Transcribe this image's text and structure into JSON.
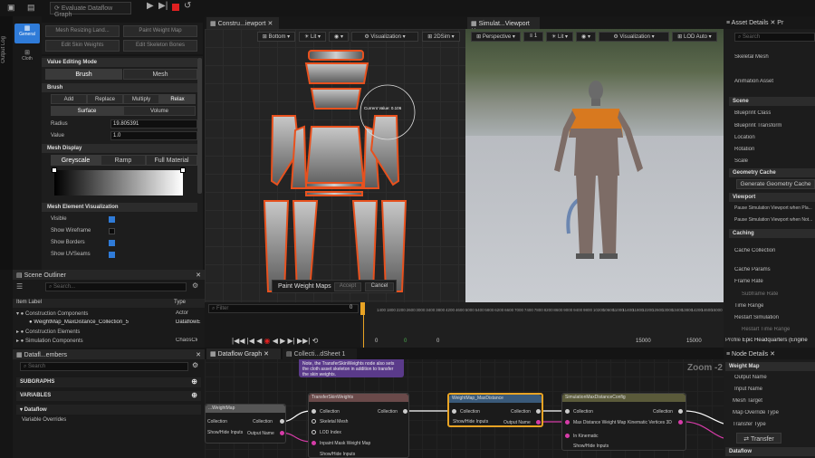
{
  "toolbar": {
    "title": "Evaluate Dataflow Graph"
  },
  "leftstrip": {
    "outputlog": "Output Log",
    "general": "General",
    "cloth": "Cloth"
  },
  "tools": {
    "mesh_resizing": "Mesh Resizing Land...",
    "paint_weight_map": "Paint Weight Map",
    "edit_skin_weights": "Edit Skin Weights",
    "edit_skeleton_bones": "Edit Skeleton Bones"
  },
  "props": {
    "value_editing_mode": "Value Editing Mode",
    "brush_tab": "Brush",
    "mesh_tab": "Mesh",
    "brush_section": "Brush",
    "add": "Add",
    "replace": "Replace",
    "multiply": "Multiply",
    "relax": "Relax",
    "surface": "Surface",
    "volume": "Volume",
    "radius_label": "Radius",
    "radius_value": "19.805391",
    "value_label": "Value",
    "value_value": "1.0",
    "mesh_display": "Mesh Display",
    "greyscale": "Greyscale",
    "ramp": "Ramp",
    "full_material": "Full Material",
    "mesh_element_vis": "Mesh Element Visualization",
    "visible": "Visible",
    "show_wireframe": "Show Wireframe",
    "show_borders": "Show Borders",
    "show_uvseams": "Show UVSeams"
  },
  "outliner": {
    "title": "Scene Outliner",
    "search_placeholder": "Search...",
    "col_label": "Item Label",
    "col_type": "Type",
    "rows": [
      {
        "label": "Construction Components",
        "type": "Actor"
      },
      {
        "label": "WeightMap_MaxDistance_Collection_5",
        "type": "DataflowE"
      },
      {
        "label": "Construction Elements",
        "type": ""
      },
      {
        "label": "Simulation Components",
        "type": "ChaosClo"
      }
    ]
  },
  "dataflow_members": {
    "title": "Datafl...embers",
    "search_placeholder": "Search",
    "subgraphs": "SUBGRAPHS",
    "variables": "VARIABLES",
    "dataflow": "Dataflow",
    "variable_overrides": "Variable Overrides"
  },
  "vp1": {
    "tab": "Constru...iewport",
    "bottom": "Bottom",
    "lit": "Lit",
    "visualization": "Visualization",
    "twodsim": "2DSim",
    "current_value": "Current Value: 0.106",
    "paint_label": "Paint Weight Maps",
    "accept": "Accept",
    "cancel": "Cancel"
  },
  "vp2": {
    "tab": "Simulat...Viewport",
    "perspective": "Perspective",
    "one": "1",
    "lit": "Lit",
    "visualization": "Visualization",
    "lod": "LOD Auto"
  },
  "timeline": {
    "filter_placeholder": "Filter",
    "frame": "0",
    "ticks": [
      "1400",
      "1800",
      "2200",
      "2600",
      "3000",
      "3400",
      "3800",
      "4200",
      "4600",
      "5000",
      "5400",
      "5800",
      "6200",
      "6600",
      "7000",
      "7400",
      "7800",
      "8200",
      "8600",
      "9000",
      "9400",
      "9800",
      "10200",
      "10600",
      "11000",
      "11400",
      "11800",
      "12200",
      "12600",
      "13000",
      "13400",
      "13800",
      "14200",
      "14600",
      "15000"
    ],
    "start": "0",
    "cur": "0",
    "end1": "15000",
    "end2": "15000"
  },
  "graph": {
    "tab1": "Dataflow Graph",
    "tab2": "Collecti...dSheet 1",
    "zoom": "Zoom -2",
    "comment": "Note, the TransferSkinWeights node also sets the cloth asset skeleton in addition to transfer the skin weights.",
    "nodes": {
      "wm": {
        "title": "...WeightMap",
        "collection": "Collection",
        "show_hide": "Show/Hide Inputs"
      },
      "tsw": {
        "title": "TransferSkinWeights",
        "collection": "Collection",
        "skeletal_mesh": "Skeletal Mesh",
        "lod_index": "LOD Index",
        "inpaint": "Inpaint Mask Weight Map",
        "show_hide": "Show/Hide Inputs"
      },
      "wmd": {
        "title": "WeightMap_MaxDistance",
        "collection": "Collection",
        "show_hide": "Show/Hide Inputs",
        "output_name": "Output Name"
      },
      "smc": {
        "title": "SimulationMaxDistanceConfig",
        "collection": "Collection",
        "max_dist": "Max Distance Weight Map",
        "kinematic": "Kinematic Vertices 3D",
        "in_kinematic": "In Kinematic",
        "show_hide": "Show/Hide Inputs"
      }
    },
    "left_node_labels": {
      "collection_out": "Collection",
      "output_name": "Output Name",
      "collection_in": "Collection"
    }
  },
  "details": {
    "title": "Asset Details",
    "tab2": "Pr",
    "search_placeholder": "Search",
    "skeletal_mesh": "Skeletal Mesh",
    "animation_asset": "Animation Asset",
    "scene": "Scene",
    "blueprint_class": "Blueprint Class",
    "blueprint_transform": "Blueprint Transform",
    "location": "Location",
    "rotation": "Rotation",
    "scale": "Scale",
    "geometry_cache": "Geometry Cache",
    "generate_gc": "Generate Geometry Cache",
    "viewport": "Viewport",
    "pause_vp_pla": "Pause Simulation Viewport when Pla...",
    "pause_vp_not": "Pause Simulation Viewport when Not...",
    "caching": "Caching",
    "cache_collection": "Cache Collection",
    "cache_params": "Cache Params",
    "frame_rate": "Frame Rate",
    "subframe_rate": "Subframe Rate",
    "time_range": "Time Range",
    "restart_sim": "Restart Simulation",
    "restart_time_range": "Restart Time Range",
    "profile_label": "Profile",
    "profile_value": "Epic Headquarters (Engine"
  },
  "node_details": {
    "title": "Node Details",
    "weight_map": "Weight Map",
    "output_name": "Output Name",
    "input_name": "Input Name",
    "mesh_target": "Mesh Target",
    "map_override_type": "Map Override Type",
    "transfer_type": "Transfer Type",
    "transfer": "Transfer",
    "dataflow": "Dataflow"
  },
  "colors": {
    "accent": "#2f7bd8",
    "orange": "#e8511e",
    "node_highlight": "#e8a324",
    "pin_magenta": "#d63ca8"
  }
}
